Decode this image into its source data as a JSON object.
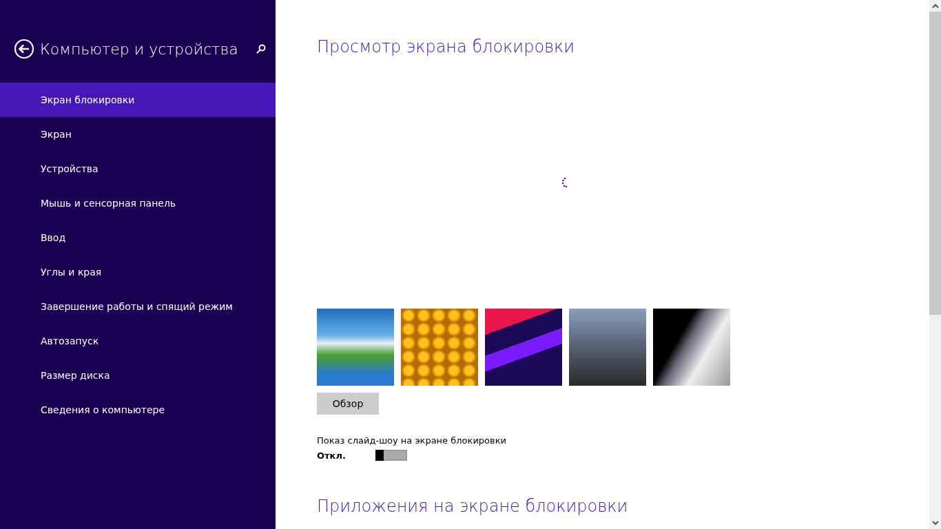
{
  "sidebar": {
    "title": "Компьютер и устройства",
    "items": [
      {
        "label": "Экран блокировки",
        "selected": true
      },
      {
        "label": "Экран",
        "selected": false
      },
      {
        "label": "Устройства",
        "selected": false
      },
      {
        "label": "Мышь и сенсорная панель",
        "selected": false
      },
      {
        "label": "Ввод",
        "selected": false
      },
      {
        "label": "Углы и края",
        "selected": false
      },
      {
        "label": "Завершение работы и спящий режим",
        "selected": false
      },
      {
        "label": "Автозапуск",
        "selected": false
      },
      {
        "label": "Размер диска",
        "selected": false
      },
      {
        "label": "Сведения о компьютере",
        "selected": false
      }
    ]
  },
  "content": {
    "preview_heading": "Просмотр экрана блокировки",
    "thumbnails": [
      {
        "kind": "landscape"
      },
      {
        "kind": "honeycomb"
      },
      {
        "kind": "abstract"
      },
      {
        "kind": "tunnel"
      },
      {
        "kind": "piano"
      }
    ],
    "browse_button": "Обзор",
    "slideshow": {
      "label": "Показ слайд-шоу на экране блокировки",
      "state_text": "Откл.",
      "on": false
    },
    "apps_heading": "Приложения на экране блокировки"
  }
}
